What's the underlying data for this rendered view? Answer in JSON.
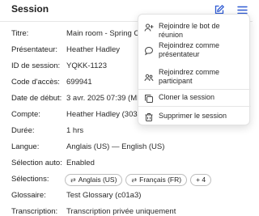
{
  "header": {
    "title": "Session",
    "edit_icon": "pencil-square-icon",
    "menu_icon": "hamburger-menu-icon"
  },
  "fields": [
    {
      "label": "Titre:",
      "value": "Main room - Spring Co"
    },
    {
      "label": "Présentateur:",
      "value": "Heather Hadley"
    },
    {
      "label": "ID de session:",
      "value": "YQKK-1123"
    },
    {
      "label": "Code d'accès:",
      "value": "699941"
    },
    {
      "label": "Date de début:",
      "value": "3 avr. 2025 07:39 (MD"
    },
    {
      "label": "Compte:",
      "value": "Heather Hadley (303b0"
    },
    {
      "label": "Durée:",
      "value": "1 hrs"
    },
    {
      "label": "Langue:",
      "value": "Anglais (US) — English (US)"
    },
    {
      "label": "Sélection auto:",
      "value": "Enabled"
    },
    {
      "label": "Sélections:",
      "chips": [
        "Anglais (US)",
        "Français (FR)",
        "+ 4"
      ]
    },
    {
      "label": "Glossaire:",
      "value": "Test Glossary (c01a3)"
    },
    {
      "label": "Transcription:",
      "value": "Transcription privée uniquement"
    }
  ],
  "menu": {
    "items": [
      {
        "label": "Rejoindre le bot de réunion",
        "icon": "user-add-icon"
      },
      {
        "label": "Rejoindrez comme présentateur",
        "icon": "chat-bubble-icon"
      },
      {
        "label": "Rejoindrez comme participant",
        "icon": "users-icon"
      },
      {
        "label": "Cloner la session",
        "icon": "copy-icon"
      },
      {
        "label": "Supprimer le session",
        "icon": "trash-icon"
      }
    ]
  },
  "colors": {
    "accent": "#2f5bd3",
    "text": "#1f1f1f",
    "border": "#e2e2e2"
  }
}
